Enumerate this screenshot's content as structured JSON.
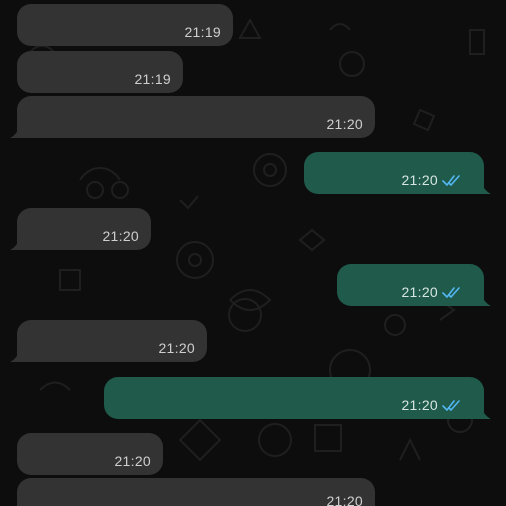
{
  "colors": {
    "incoming_bubble": "#333333",
    "outgoing_bubble": "#1f5a4b",
    "read_ticks": "#52b6f1",
    "background": "#0d0d0d"
  },
  "messages": [
    {
      "direction": "incoming",
      "time": "21:19"
    },
    {
      "direction": "incoming",
      "time": "21:19"
    },
    {
      "direction": "incoming",
      "time": "21:20"
    },
    {
      "direction": "outgoing",
      "time": "21:20",
      "status_icon": "double-check-read-icon"
    },
    {
      "direction": "incoming",
      "time": "21:20"
    },
    {
      "direction": "outgoing",
      "time": "21:20",
      "status_icon": "double-check-read-icon"
    },
    {
      "direction": "incoming",
      "time": "21:20"
    },
    {
      "direction": "outgoing",
      "time": "21:20",
      "status_icon": "double-check-read-icon"
    },
    {
      "direction": "incoming",
      "time": "21:20"
    },
    {
      "direction": "incoming",
      "time": "21:20"
    }
  ]
}
